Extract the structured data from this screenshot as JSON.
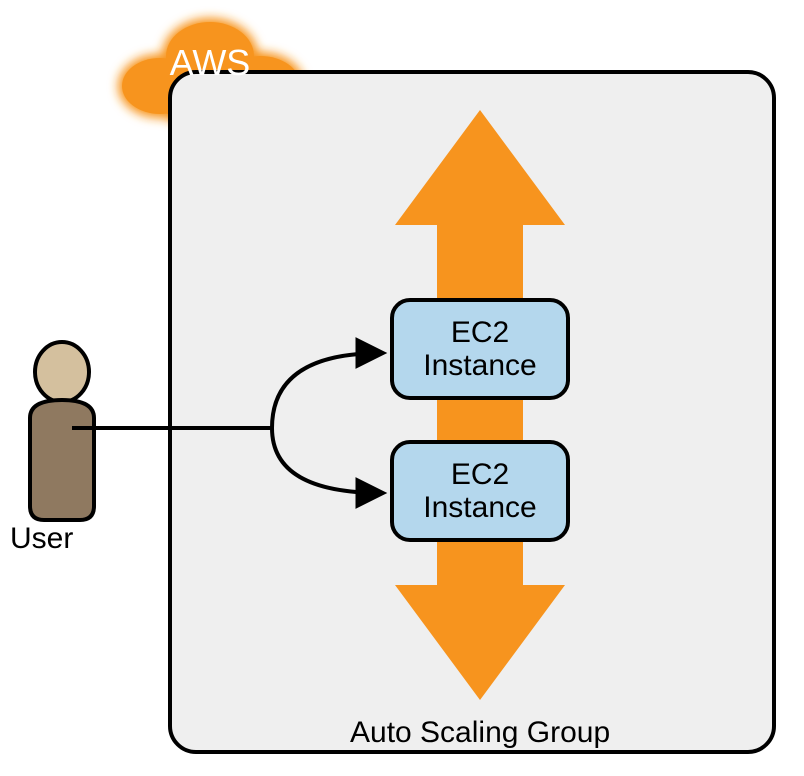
{
  "cloud": {
    "label": "AWS",
    "color": "#f7941e"
  },
  "user": {
    "label": "User"
  },
  "container": {
    "label": "Auto Scaling Group"
  },
  "instances": [
    {
      "label": "EC2\nInstance"
    },
    {
      "label": "EC2\nInstance"
    }
  ],
  "colors": {
    "orange": "#f7941e",
    "box_fill": "#b4d7ed",
    "panel": "#efefef"
  }
}
